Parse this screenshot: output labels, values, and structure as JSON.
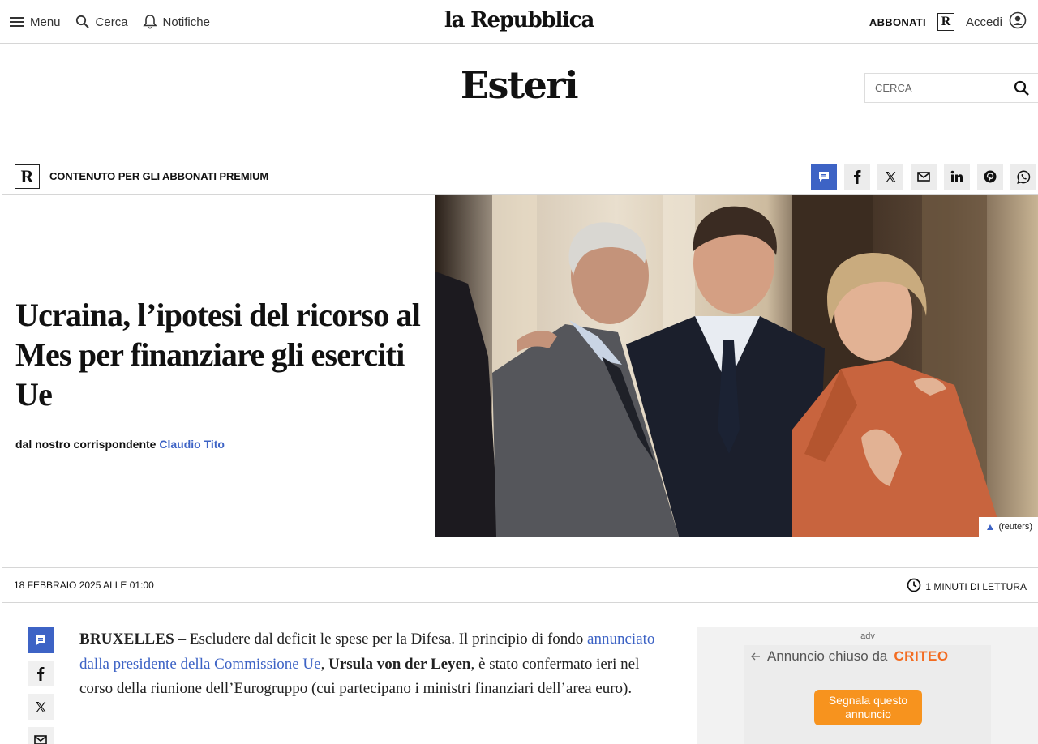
{
  "topbar": {
    "menu_label": "Menu",
    "search_label": "Cerca",
    "notifications_label": "Notifiche",
    "logo": "la Repubblica",
    "subscribe_label": "ABBONATI",
    "r_badge": "R",
    "login_label": "Accedi"
  },
  "section": {
    "title": "Esteri",
    "search_placeholder": "CERCA"
  },
  "premium": {
    "badge": "R",
    "label": "CONTENUTO PER GLI ABBONATI PREMIUM"
  },
  "article": {
    "headline": "Ucraina, l’ipotesi del ricorso al Mes per finanziare gli eserciti Ue",
    "byline_prefix": "dal nostro corrispondente",
    "author": "Claudio Tito",
    "photo_credit": "(reuters)",
    "date": "18 febbraio 2025 alle 01:00",
    "reading_time": "1 MINUTI DI LETTURA",
    "location": "BRUXELLES",
    "dash": " – ",
    "p1_part1": "Escludere dal deficit le spese per la Difesa. Il principio di fondo ",
    "p1_link": "annunciato dalla presidente della Commissione Ue",
    "p1_comma": ", ",
    "p1_bold": "Ursula von der Leyen",
    "p1_part2": ", è stato confermato ieri nel corso della riunione dell’Eurogruppo (cui partecipano i ministri finanziari dell’area euro)."
  },
  "share_icons": [
    "comment-icon",
    "facebook-icon",
    "x-icon",
    "mail-icon",
    "linkedin-icon",
    "pinterest-icon",
    "whatsapp-icon"
  ],
  "ad": {
    "label": "adv",
    "closed_text": "Annuncio chiuso da",
    "brand": "CRITEO",
    "report_button": "Segnala questo annuncio"
  },
  "colors": {
    "accent_blue": "#3d63c5",
    "criteo_orange": "#f36c21",
    "report_button": "#f7931e"
  }
}
